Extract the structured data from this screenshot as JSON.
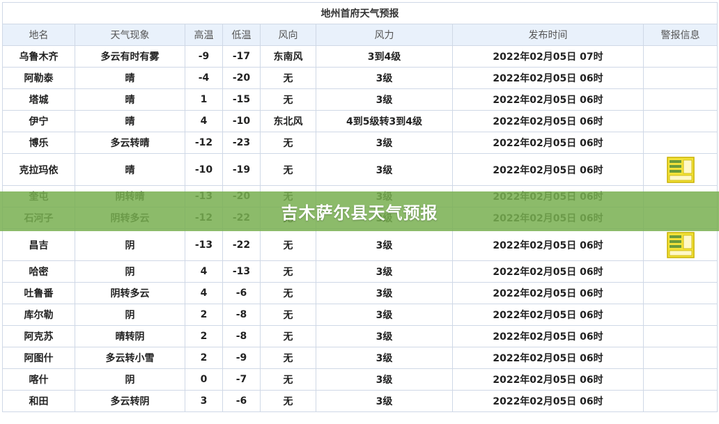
{
  "table": {
    "title": "地州首府天气预报",
    "headers": [
      "地名",
      "天气现象",
      "高温",
      "低温",
      "风向",
      "风力",
      "发布时间",
      "警报信息"
    ],
    "rows": [
      {
        "place": "乌鲁木齐",
        "weather": "多云有时有雾",
        "high": "-9",
        "low": "-17",
        "wind_dir": "东南风",
        "wind_force": "3到4级",
        "time": "2022年02月05日 07时",
        "warning": false
      },
      {
        "place": "阿勒泰",
        "weather": "晴",
        "high": "-4",
        "low": "-20",
        "wind_dir": "无",
        "wind_force": "3级",
        "time": "2022年02月05日 06时",
        "warning": false
      },
      {
        "place": "塔城",
        "weather": "晴",
        "high": "1",
        "low": "-15",
        "wind_dir": "无",
        "wind_force": "3级",
        "time": "2022年02月05日 06时",
        "warning": false
      },
      {
        "place": "伊宁",
        "weather": "晴",
        "high": "4",
        "low": "-10",
        "wind_dir": "东北风",
        "wind_force": "4到5级转3到4级",
        "time": "2022年02月05日 06时",
        "warning": false
      },
      {
        "place": "博乐",
        "weather": "多云转晴",
        "high": "-12",
        "low": "-23",
        "wind_dir": "无",
        "wind_force": "3级",
        "time": "2022年02月05日 06时",
        "warning": false
      },
      {
        "place": "克拉玛依",
        "weather": "晴",
        "high": "-10",
        "low": "-19",
        "wind_dir": "无",
        "wind_force": "3级",
        "time": "2022年02月05日 06时",
        "warning": true
      },
      {
        "place": "奎屯",
        "weather": "阴转晴",
        "high": "-13",
        "low": "-20",
        "wind_dir": "无",
        "wind_force": "3级",
        "time": "2022年02月05日 06时",
        "warning": false
      },
      {
        "place": "石河子",
        "weather": "阴转多云",
        "high": "-12",
        "low": "-22",
        "wind_dir": "无",
        "wind_force": "3级",
        "time": "2022年02月05日 06时",
        "warning": false
      },
      {
        "place": "昌吉",
        "weather": "阴",
        "high": "-13",
        "low": "-22",
        "wind_dir": "无",
        "wind_force": "3级",
        "time": "2022年02月05日 06时",
        "warning": true
      },
      {
        "place": "哈密",
        "weather": "阴",
        "high": "4",
        "low": "-13",
        "wind_dir": "无",
        "wind_force": "3级",
        "time": "2022年02月05日 06时",
        "warning": false
      },
      {
        "place": "吐鲁番",
        "weather": "阴转多云",
        "high": "4",
        "low": "-6",
        "wind_dir": "无",
        "wind_force": "3级",
        "time": "2022年02月05日 06时",
        "warning": false
      },
      {
        "place": "库尔勒",
        "weather": "阴",
        "high": "2",
        "low": "-8",
        "wind_dir": "无",
        "wind_force": "3级",
        "time": "2022年02月05日 06时",
        "warning": false
      },
      {
        "place": "阿克苏",
        "weather": "晴转阴",
        "high": "2",
        "low": "-8",
        "wind_dir": "无",
        "wind_force": "3级",
        "time": "2022年02月05日 06时",
        "warning": false
      },
      {
        "place": "阿图什",
        "weather": "多云转小雪",
        "high": "2",
        "low": "-9",
        "wind_dir": "无",
        "wind_force": "3级",
        "time": "2022年02月05日 06时",
        "warning": false
      },
      {
        "place": "喀什",
        "weather": "阴",
        "high": "0",
        "low": "-7",
        "wind_dir": "无",
        "wind_force": "3级",
        "time": "2022年02月05日 06时",
        "warning": false
      },
      {
        "place": "和田",
        "weather": "多云转阴",
        "high": "3",
        "low": "-6",
        "wind_dir": "无",
        "wind_force": "3级",
        "time": "2022年02月05日 06时",
        "warning": false
      }
    ]
  },
  "warning_icon": {
    "name": "warning-signal-icon",
    "colors": {
      "yellow": "#f2e23a",
      "green": "#6a9a3b",
      "border": "#c9b100"
    }
  },
  "banner": {
    "text": "吉木萨尔县天气预报",
    "color": "#78af50"
  }
}
